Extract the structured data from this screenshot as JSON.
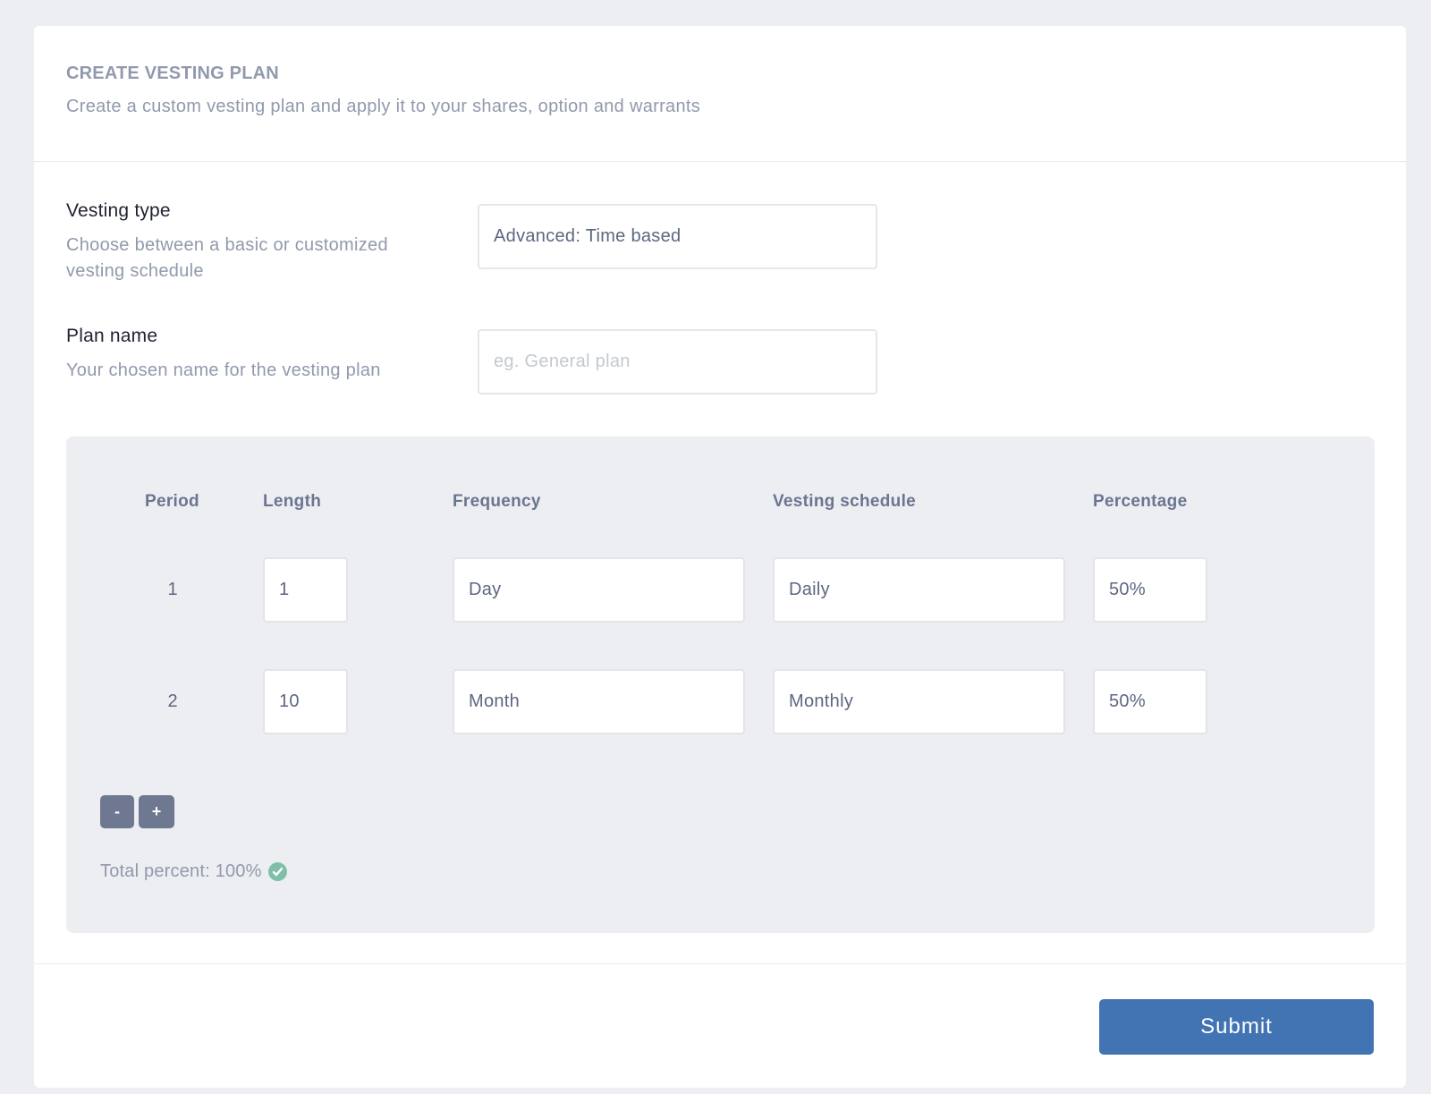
{
  "header": {
    "title": "CREATE VESTING PLAN",
    "subtitle": "Create a custom vesting plan and apply it to your shares, option and warrants"
  },
  "vesting_type": {
    "label": "Vesting type",
    "help": "Choose between a basic or customized vesting schedule",
    "value": "Advanced: Time based"
  },
  "plan_name": {
    "label": "Plan name",
    "help": "Your chosen name for the vesting plan",
    "value": "",
    "placeholder": "eg. General plan"
  },
  "schedule": {
    "columns": [
      "Period",
      "Length",
      "Frequency",
      "Vesting schedule",
      "Percentage"
    ],
    "rows": [
      {
        "period": "1",
        "length": "1",
        "frequency": "Day",
        "vesting_schedule": "Daily",
        "percentage": "50%"
      },
      {
        "period": "2",
        "length": "10",
        "frequency": "Month",
        "vesting_schedule": "Monthly",
        "percentage": "50%"
      }
    ],
    "remove_label": "-",
    "add_label": "+",
    "total_label": "Total percent: 100%",
    "total_status": "valid"
  },
  "footer": {
    "submit_label": "Submit"
  },
  "colors": {
    "primary": "#4274b4",
    "success": "#7fbfa8",
    "muted_button": "#6e7891"
  }
}
